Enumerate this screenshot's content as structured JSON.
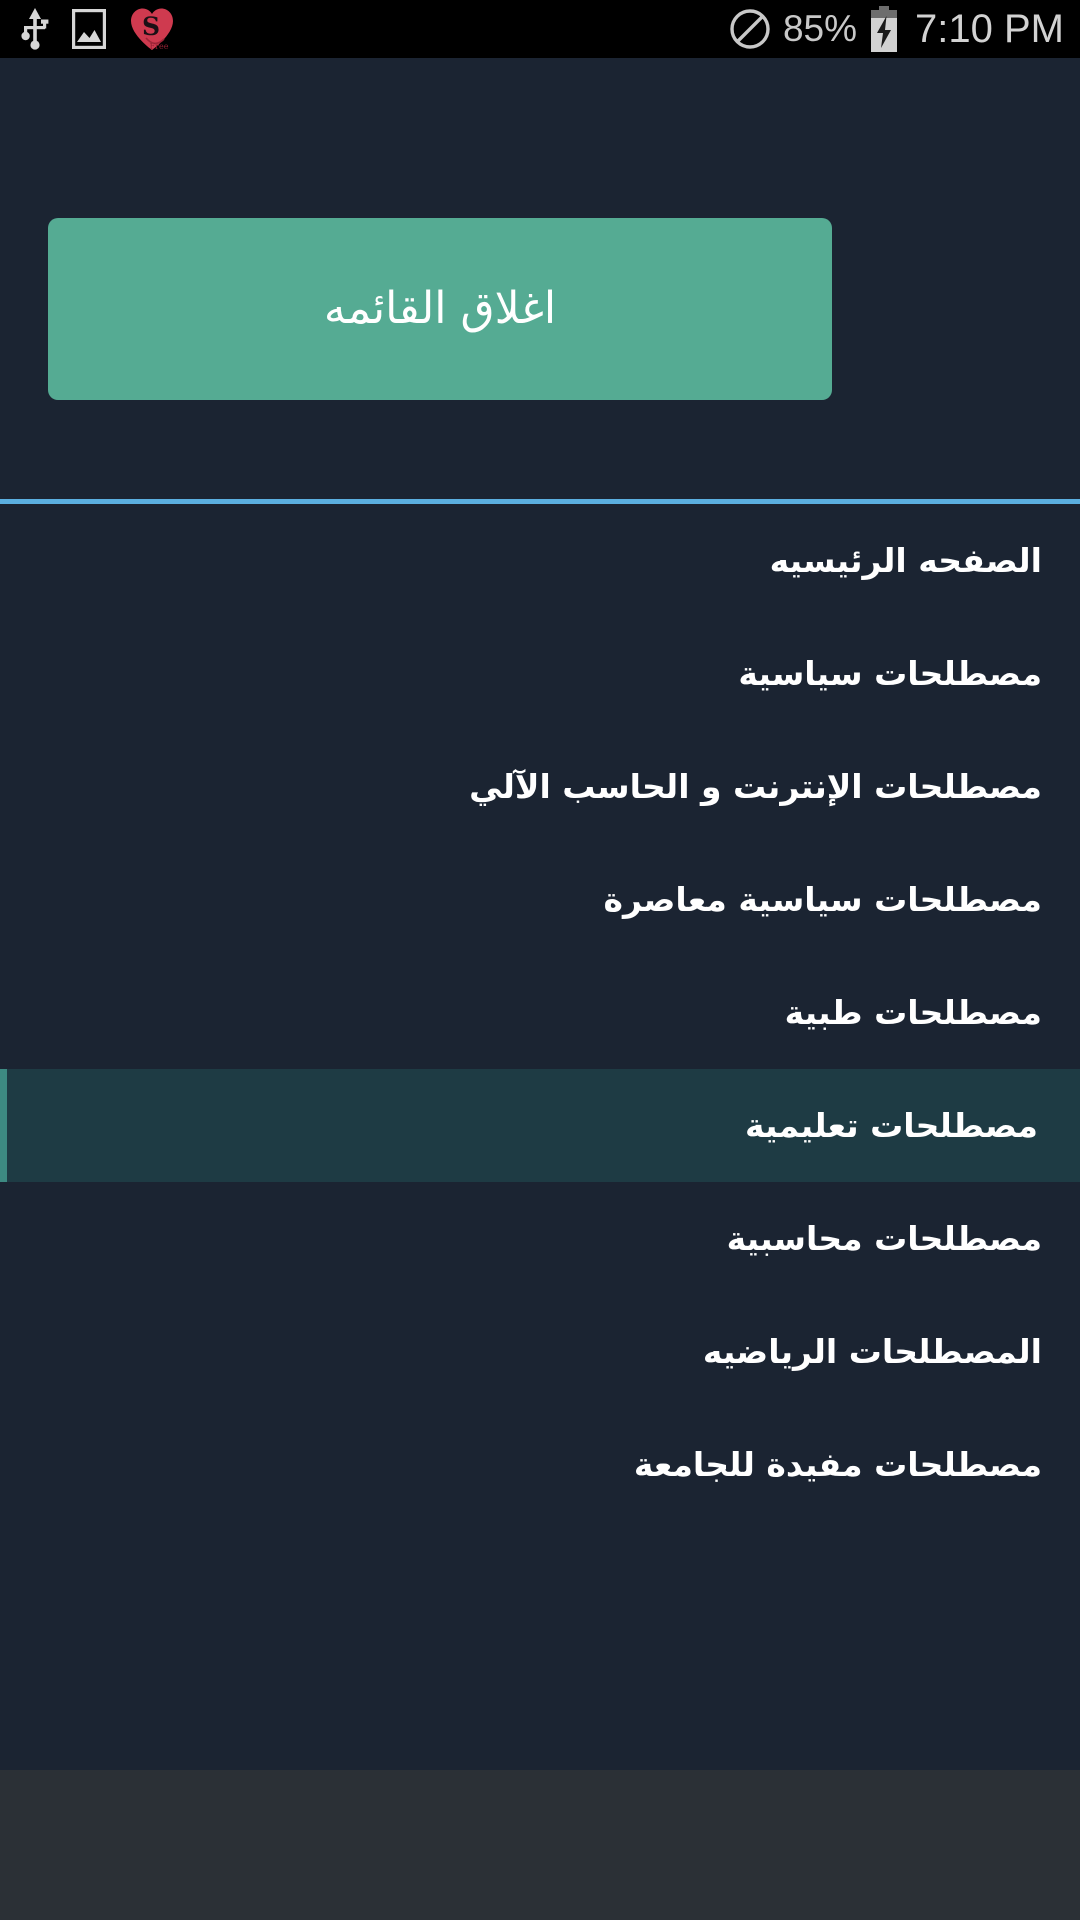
{
  "status_bar": {
    "left_icons": [
      {
        "name": "usb-icon",
        "label": "USB"
      },
      {
        "name": "gallery-image-icon",
        "label": "Screenshot"
      },
      {
        "name": "heart-s-free-app-icon",
        "label": "S Free"
      }
    ],
    "heart_logo_letter": "S",
    "heart_logo_sub": "Free",
    "dnd_icon_name": "do-not-disturb-icon",
    "battery_percent": "85%",
    "battery_icon_name": "battery-charging-icon",
    "clock": "7:10 PM",
    "colors": {
      "background": "#000000",
      "text": "#c8c8c8",
      "heart": "#cf3a4f"
    }
  },
  "drawer": {
    "close_button_label": "اغلاق القائمه",
    "divider_color": "#5bafe0",
    "background_color": "#1b2432",
    "button_color": "#55ab93",
    "selected_background": "#1e3b44",
    "selected_accent": "#3d8a82",
    "items": [
      {
        "label": "الصفحه الرئيسيه",
        "selected": false
      },
      {
        "label": "مصطلحات سياسية",
        "selected": false
      },
      {
        "label": "مصطلحات الإنترنت و الحاسب الآلي",
        "selected": false
      },
      {
        "label": "مصطلحات سياسية معاصرة",
        "selected": false
      },
      {
        "label": "مصطلحات طبية",
        "selected": false
      },
      {
        "label": "مصطلحات تعليمية",
        "selected": true
      },
      {
        "label": "مصطلحات محاسبية",
        "selected": false
      },
      {
        "label": "المصطلحات الرياضيه",
        "selected": false
      },
      {
        "label": "مصطلحات مفيدة للجامعة",
        "selected": false
      }
    ]
  },
  "bottom_area": {
    "background_color": "#2b3036"
  }
}
